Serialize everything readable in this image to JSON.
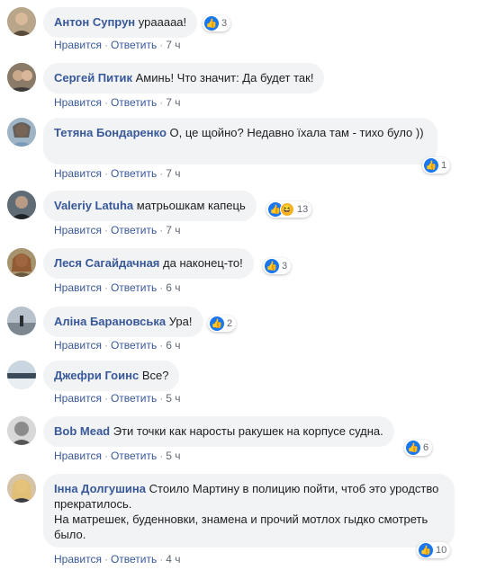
{
  "comments": [
    {
      "author": "Антон Супрун",
      "text": "урааааа!",
      "likes": "3",
      "like_label": "Нравится",
      "reply_label": "Ответить",
      "time": "7 ч"
    },
    {
      "author": "Сергей Питик",
      "text": "Аминь! Что значит: Да будет так!",
      "likes": "",
      "like_label": "Нравится",
      "reply_label": "Ответить",
      "time": "7 ч"
    },
    {
      "author": "Тетяна Бондаренко",
      "text": "О, це щойно? Недавно їхала там - тихо було ))",
      "likes": "1",
      "like_label": "Нравится",
      "reply_label": "Ответить",
      "time": "7 ч"
    },
    {
      "author": "Valeriy Latuha",
      "text": "матрьошкам капець",
      "likes": "13",
      "like_label": "Нравится",
      "reply_label": "Ответить",
      "time": "7 ч"
    },
    {
      "author": "Леся Сагайдачная",
      "text": "да наконец-то!",
      "likes": "3",
      "like_label": "Нравится",
      "reply_label": "Ответить",
      "time": "6 ч"
    },
    {
      "author": "Аліна Барановська",
      "text": "Ура!",
      "likes": "2",
      "like_label": "Нравится",
      "reply_label": "Ответить",
      "time": "6 ч"
    },
    {
      "author": "Джефри Гоинс",
      "text": "Все?",
      "likes": "",
      "like_label": "Нравится",
      "reply_label": "Ответить",
      "time": "5 ч"
    },
    {
      "author": "Bob Mead",
      "text": "Эти точки как наросты ракушек на корпусе судна.",
      "likes": "6",
      "like_label": "Нравится",
      "reply_label": "Ответить",
      "time": "5 ч"
    },
    {
      "author": "Інна Долгушина",
      "text": "Стоило Мартину в полицию пойти, чтоб это уродство прекратилось.",
      "text2": "На матрешек, буденновки, знамена и прочий мотлох гыдко смотреть было.",
      "likes": "10",
      "like_label": "Нравится",
      "reply_label": "Ответить",
      "time": "4 ч"
    }
  ],
  "icons": {
    "like": "thumbs-up-icon",
    "haha": "laughing-face-icon"
  },
  "colors": {
    "author": "#385898",
    "bubble": "#f2f3f5",
    "like": "#1877f2",
    "meta": "#606770"
  }
}
